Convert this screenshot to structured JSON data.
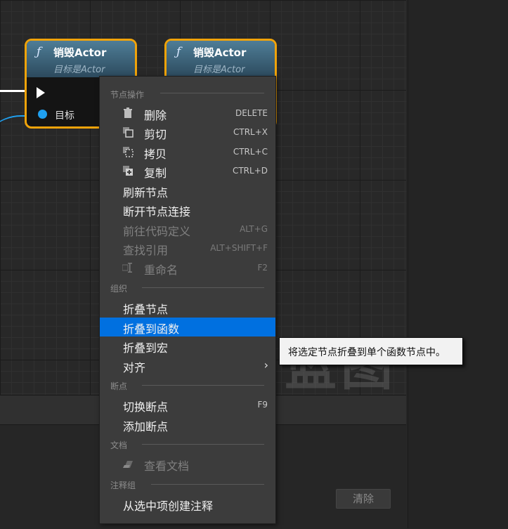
{
  "nodes": [
    {
      "func_symbol": "ƒ",
      "title": "销毁Actor",
      "subtitle": "目标是Actor",
      "target_label": "目标"
    },
    {
      "func_symbol": "ƒ",
      "title": "销毁Actor",
      "subtitle": "目标是Actor"
    }
  ],
  "watermark": "蓝图",
  "clear_button": "清除",
  "menu": {
    "sections": {
      "node_actions": "节点操作",
      "organize": "组织",
      "breakpoints": "断点",
      "docs": "文档",
      "comment_group": "注释组"
    },
    "items": {
      "delete": {
        "label": "删除",
        "shortcut": "DELETE"
      },
      "cut": {
        "label": "剪切",
        "shortcut": "CTRL+X"
      },
      "copy": {
        "label": "拷贝",
        "shortcut": "CTRL+C"
      },
      "duplicate": {
        "label": "复制",
        "shortcut": "CTRL+D"
      },
      "refresh": {
        "label": "刷新节点"
      },
      "break_links": {
        "label": "断开节点连接"
      },
      "goto_code": {
        "label": "前往代码定义",
        "shortcut": "ALT+G"
      },
      "find_refs": {
        "label": "查找引用",
        "shortcut": "ALT+SHIFT+F"
      },
      "rename": {
        "label": "重命名",
        "shortcut": "F2"
      },
      "collapse_nodes": {
        "label": "折叠节点"
      },
      "collapse_function": {
        "label": "折叠到函数"
      },
      "collapse_macro": {
        "label": "折叠到宏"
      },
      "align": {
        "label": "对齐"
      },
      "toggle_bp": {
        "label": "切换断点",
        "shortcut": "F9"
      },
      "add_bp": {
        "label": "添加断点"
      },
      "view_docs": {
        "label": "查看文档"
      },
      "create_comment": {
        "label": "从选中项创建注释"
      }
    }
  },
  "tooltip": "将选定节点折叠到单个函数节点中。",
  "colors": {
    "highlight": "#0070e0",
    "node_border": "#f0a30a",
    "pin_blue": "#1fa0f0"
  }
}
